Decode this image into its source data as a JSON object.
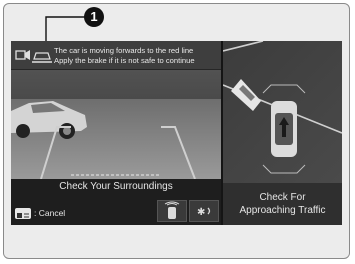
{
  "callout": {
    "number": "1"
  },
  "screen": {
    "message_line1": "The car is moving forwards to the red line",
    "message_line2": "Apply the brake if it is not safe to continue",
    "left_label": "Check Your Surroundings",
    "right_label_line1": "Check For",
    "right_label_line2": "Approaching Traffic",
    "cancel_label": ": Cancel"
  },
  "icons": {
    "camera_warning": "camera-warning-icon",
    "cancel_button": "cancel-button-icon",
    "parking_sensor": "parking-sensor-icon",
    "camera_view": "camera-view-icon"
  },
  "colors": {
    "guide_line_red": "#d8d8d8",
    "screen_bg": "#2a2a2a",
    "frame_bg": "#ececec"
  }
}
